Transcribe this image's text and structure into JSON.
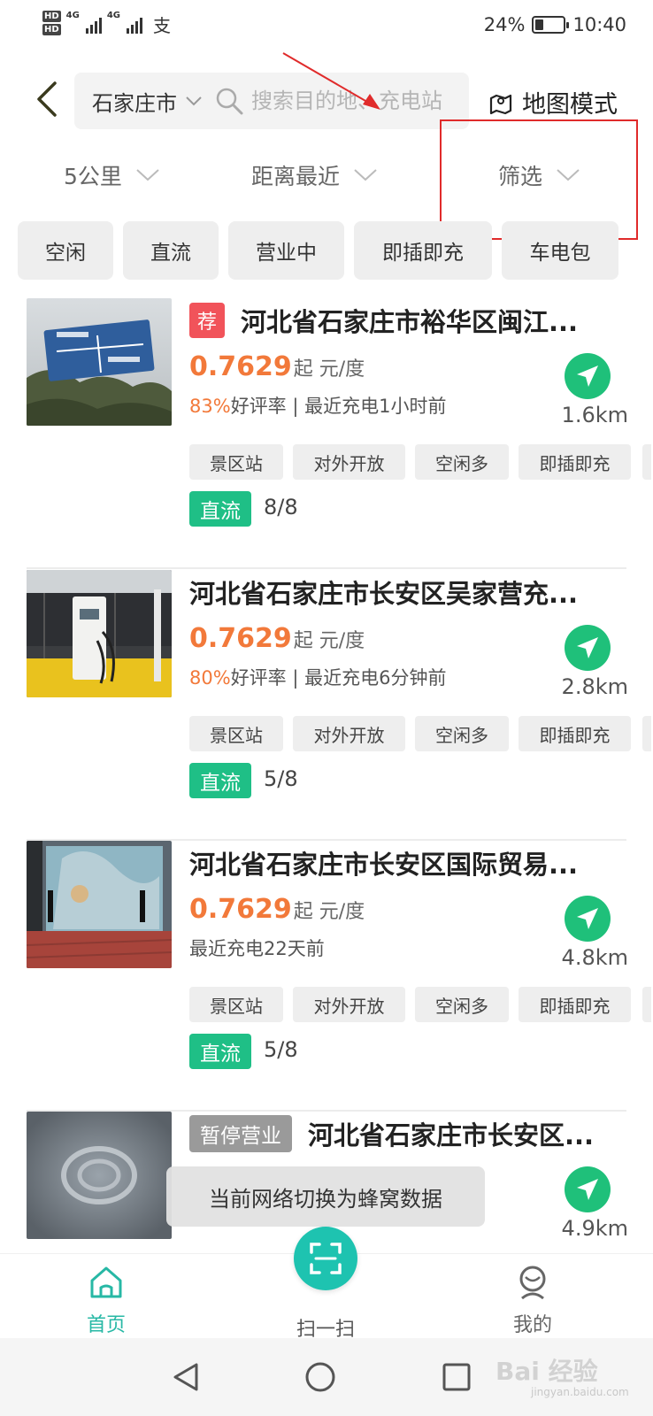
{
  "status_bar": {
    "hd1": "HD",
    "hd2": "HD",
    "net1": "4G",
    "net2": "4G",
    "battery_pct_label": "24%",
    "battery_level": 0.24,
    "time": "10:40"
  },
  "header": {
    "city": "石家庄市",
    "search_placeholder": "搜索目的地、充电站",
    "map_mode_label": "地图模式"
  },
  "filters": {
    "distance": "5公里",
    "sort": "距离最近",
    "screen": "筛选"
  },
  "chips": [
    "空闲",
    "直流",
    "营业中",
    "即插即充",
    "车电包"
  ],
  "stations": [
    {
      "recommended_tag": "荐",
      "title": "河北省石家庄市裕华区闽江...",
      "price": "0.7629",
      "price_unit": "起 元/度",
      "rating_pct": "83%",
      "rating_text": "好评率 | 最近充电1小时前",
      "distance": "1.6km",
      "tags": [
        "景区站",
        "对外开放",
        "空闲多",
        "即插即充"
      ],
      "current_type": "直流",
      "ports": "8/8"
    },
    {
      "title": "河北省石家庄市长安区吴家营充...",
      "price": "0.7629",
      "price_unit": "起 元/度",
      "rating_pct": "80%",
      "rating_text": "好评率 | 最近充电6分钟前",
      "distance": "2.8km",
      "tags": [
        "景区站",
        "对外开放",
        "空闲多",
        "即插即充"
      ],
      "current_type": "直流",
      "ports": "5/8"
    },
    {
      "title": "河北省石家庄市长安区国际贸易...",
      "price": "0.7629",
      "price_unit": "起 元/度",
      "recent_text": "最近充电22天前",
      "distance": "4.8km",
      "tags": [
        "景区站",
        "对外开放",
        "空闲多",
        "即插即充"
      ],
      "current_type": "直流",
      "ports": "5/8"
    },
    {
      "closed_tag": "暂停营业",
      "title": "河北省石家庄市长安区...",
      "distance": "4.9km"
    }
  ],
  "toast": "当前网络切换为蜂窝数据",
  "tabbar": {
    "home": "首页",
    "scan": "扫一扫",
    "mine": "我的"
  },
  "watermark": {
    "main": "Bai 经验",
    "sub": "jingyan.baidu.com"
  },
  "colors": {
    "accent_teal": "#1ec3b0",
    "price_orange": "#f2793a",
    "nav_green": "#1fc07a",
    "dc_green": "#1fbf86",
    "recommend_red": "#f1535a",
    "annotation_red": "#e02b2b"
  }
}
